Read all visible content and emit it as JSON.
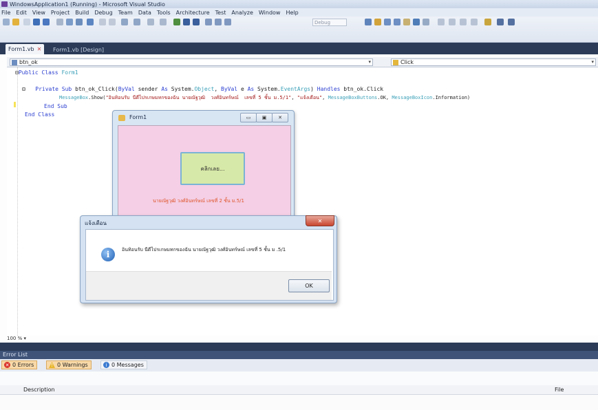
{
  "window": {
    "title": "WindowsApplication1 (Running) - Microsoft Visual Studio"
  },
  "menu": [
    "File",
    "Edit",
    "View",
    "Project",
    "Build",
    "Debug",
    "Team",
    "Data",
    "Tools",
    "Architecture",
    "Test",
    "Analyze",
    "Window",
    "Help"
  ],
  "toolbar": {
    "config_select": "Debug"
  },
  "tabs": {
    "active": "Form1.vb",
    "active_close": "✕",
    "inactive": "Form1.vb [Design]"
  },
  "nav": {
    "object": "btn_ok",
    "event": "Click"
  },
  "code": {
    "l1_kw": "Public Class",
    "l1_name": " Form1",
    "l2_kw1": "Private Sub",
    "l2_a": " btn_ok_Click(",
    "l2_kw2": "ByVal",
    "l2_b": " sender ",
    "l2_kw3": "As",
    "l2_c": " System.",
    "l2_t1": "Object",
    "l2_d": ", ",
    "l2_kw4": "ByVal",
    "l2_e": " e ",
    "l2_kw5": "As",
    "l2_f": " System.",
    "l2_t2": "EventArgs",
    "l2_g": ") ",
    "l2_kw6": "Handles",
    "l2_h": " btn_ok.Click",
    "l3_t1": "MessageBox",
    "l3_a": ".Show(",
    "l3_s1": "\"อินทิอนรับ นีดีไปรเกษมทกของฉัน นายณัฐวุฒิ  วงศ์อินทร์ษณ์  เลขที่ 5 ชั้น ม.5/1\"",
    "l3_b": ", ",
    "l3_s2": "\"แจ้งเตือน\"",
    "l3_c": ", ",
    "l3_t2": "MessageBoxButtons",
    "l3_d": ".OK, ",
    "l3_t3": "MessageBoxIcon",
    "l3_e": ".Information)",
    "l4_kw": "End Sub",
    "l5_kw": "End Class"
  },
  "zoom": "100 %",
  "form1": {
    "title": "Form1",
    "button_label": "คลิกเลย...",
    "label": "นายณัฐวุฒิ  วงศ์อินทร์ษณ์   เลขที่ 2 ชั้น ม.5/1"
  },
  "msgbox": {
    "title": "แจ้งเตือน",
    "close": "✕",
    "message": "อินทิอนรับ นีดีไปรเกษมทกของฉัน นายณัฐวุฒิ วงศ์อินทร์ษณ์ เลขที่ 5 ชั้น ม .5/1",
    "ok_label": "OK"
  },
  "error_list": {
    "header": "Error List",
    "errors": "0 Errors",
    "warnings": "0 Warnings",
    "messages": "0 Messages",
    "col_description": "Description",
    "col_file": "File"
  }
}
